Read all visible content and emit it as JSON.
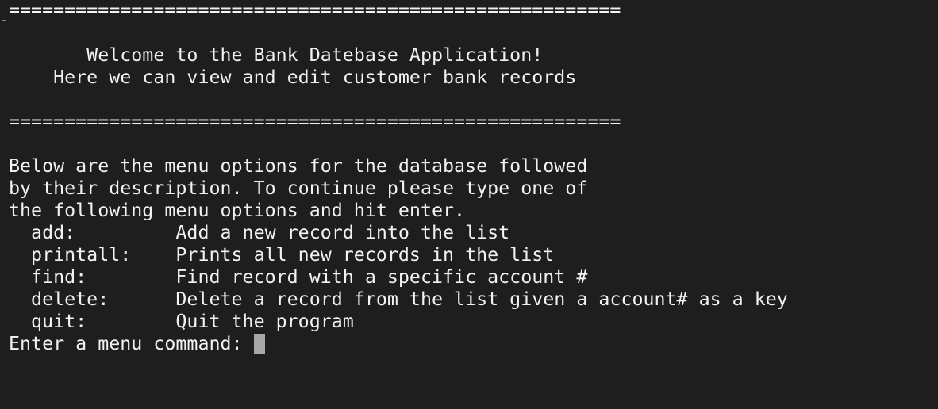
{
  "divider": "=======================================================",
  "welcome": {
    "line1": "       Welcome to the Bank Datebase Application!",
    "line2": "    Here we can view and edit customer bank records"
  },
  "intro": {
    "line1": "Below are the menu options for the database followed",
    "line2": "by their description. To continue please type one of",
    "line3": "the following menu options and hit enter."
  },
  "menu": [
    {
      "command": "  add:         ",
      "description": "Add a new record into the list"
    },
    {
      "command": "  printall:    ",
      "description": "Prints all new records in the list"
    },
    {
      "command": "  find:        ",
      "description": "Find record with a specific account #"
    },
    {
      "command": "  delete:      ",
      "description": "Delete a record from the list given a account# as a key"
    },
    {
      "command": "  quit:        ",
      "description": "Quit the program"
    }
  ],
  "prompt": "Enter a menu command: ",
  "colors": {
    "background": "#1e1e1e",
    "text": "#f2f2f2",
    "cursor": "#a8a8a8"
  }
}
